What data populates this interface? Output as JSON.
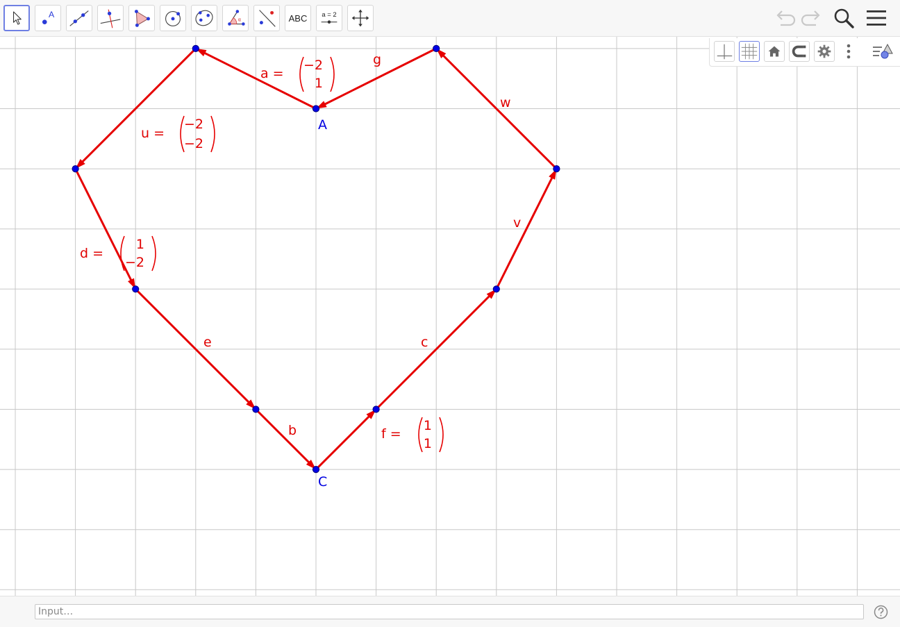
{
  "toolbar": {
    "tools": [
      {
        "id": "move",
        "icon": "pointer-arrow-icon"
      },
      {
        "id": "point",
        "icon": "point-icon",
        "glyph": "A"
      },
      {
        "id": "line",
        "icon": "line-icon"
      },
      {
        "id": "perpendicular",
        "icon": "perpendicular-line-icon"
      },
      {
        "id": "polygon",
        "icon": "polygon-icon"
      },
      {
        "id": "circle",
        "icon": "circle-center-point-icon"
      },
      {
        "id": "ellipse",
        "icon": "ellipse-icon"
      },
      {
        "id": "angle",
        "icon": "angle-icon",
        "glyph": "α"
      },
      {
        "id": "reflect",
        "icon": "reflect-line-icon"
      },
      {
        "id": "text",
        "icon": "text-icon",
        "glyph": "ABC"
      },
      {
        "id": "slider",
        "icon": "slider-icon",
        "glyph": "a = 2"
      },
      {
        "id": "move-view",
        "icon": "move-graphics-view-icon"
      }
    ],
    "right_buttons": [
      "undo-icon",
      "redo-icon",
      "search-icon",
      "menu-icon"
    ]
  },
  "style_bar": {
    "buttons": [
      "axes-toggle-icon",
      "grid-toggle-icon",
      "home-icon",
      "point-capturing-icon",
      "settings-icon",
      "more-vertical-icon",
      "style-bar-toggle-icon"
    ]
  },
  "construction": {
    "colors": {
      "vector": "#e60000",
      "point": "#0000e6",
      "grid": "#c8c8c8"
    },
    "points": [
      {
        "name": "A",
        "label": "A",
        "x": 0,
        "y": 0
      },
      {
        "name": "P1",
        "label": "",
        "x": -2,
        "y": 1
      },
      {
        "name": "P2",
        "label": "",
        "x": -4,
        "y": -1
      },
      {
        "name": "P3",
        "label": "",
        "x": -3,
        "y": -3
      },
      {
        "name": "P4",
        "label": "",
        "x": -1,
        "y": -5
      },
      {
        "name": "C",
        "label": "C",
        "x": 0,
        "y": -6
      },
      {
        "name": "P5",
        "label": "",
        "x": 1,
        "y": -5
      },
      {
        "name": "P6",
        "label": "",
        "x": 3,
        "y": -3
      },
      {
        "name": "P7",
        "label": "",
        "x": 4,
        "y": -1
      },
      {
        "name": "P8",
        "label": "",
        "x": 2,
        "y": 1
      }
    ],
    "vectors": [
      {
        "name": "a",
        "from": "A",
        "to": "P1",
        "label": "a =",
        "components": [
          "−2",
          "1"
        ]
      },
      {
        "name": "u",
        "from": "P1",
        "to": "P2",
        "label": "u =",
        "components": [
          "−2",
          "−2"
        ]
      },
      {
        "name": "d",
        "from": "P2",
        "to": "P3",
        "label": "d =",
        "components": [
          "1",
          "−2"
        ]
      },
      {
        "name": "e",
        "from": "P3",
        "to": "P4",
        "label": "e",
        "components": null
      },
      {
        "name": "b",
        "from": "P4",
        "to": "C",
        "label": "b",
        "components": null
      },
      {
        "name": "f",
        "from": "C",
        "to": "P5",
        "label": "f =",
        "components": [
          "1",
          "1"
        ]
      },
      {
        "name": "c",
        "from": "P5",
        "to": "P6",
        "label": "c",
        "components": null
      },
      {
        "name": "v",
        "from": "P6",
        "to": "P7",
        "label": "v",
        "components": null
      },
      {
        "name": "w",
        "from": "P7",
        "to": "P8",
        "label": "w",
        "components": null
      },
      {
        "name": "g",
        "from": "P8",
        "to": "A",
        "label": "g",
        "components": null
      }
    ]
  },
  "input_bar": {
    "placeholder": "Input…",
    "value": ""
  }
}
